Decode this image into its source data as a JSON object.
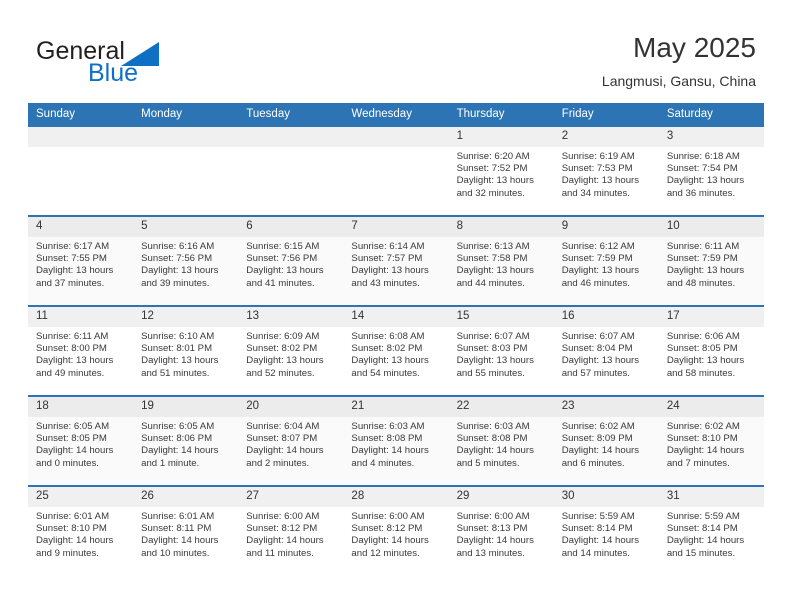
{
  "brand": {
    "name_part1": "General",
    "name_part2": "Blue",
    "accent_color": "#0f6fc5",
    "logo_icon": "triangle-flag-icon"
  },
  "header": {
    "title": "May 2025",
    "subtitle": "Langmusi, Gansu, China"
  },
  "theme": {
    "header_blue": "#2d74b5",
    "daynum_band": "#f0f0f0",
    "row_shade": "#fafafa"
  },
  "weekday_headers": [
    "Sunday",
    "Monday",
    "Tuesday",
    "Wednesday",
    "Thursday",
    "Friday",
    "Saturday"
  ],
  "labels": {
    "sunrise_prefix": "Sunrise:",
    "sunset_prefix": "Sunset:",
    "daylight_prefix": "Daylight:"
  },
  "weeks": [
    {
      "shaded": false,
      "days": [
        {
          "num": "",
          "empty": true,
          "sunrise": "",
          "sunset": "",
          "daylight_line1": "",
          "daylight_line2": ""
        },
        {
          "num": "",
          "empty": true,
          "sunrise": "",
          "sunset": "",
          "daylight_line1": "",
          "daylight_line2": ""
        },
        {
          "num": "",
          "empty": true,
          "sunrise": "",
          "sunset": "",
          "daylight_line1": "",
          "daylight_line2": ""
        },
        {
          "num": "",
          "empty": true,
          "sunrise": "",
          "sunset": "",
          "daylight_line1": "",
          "daylight_line2": ""
        },
        {
          "num": "1",
          "empty": false,
          "sunrise": "Sunrise: 6:20 AM",
          "sunset": "Sunset: 7:52 PM",
          "daylight_line1": "Daylight: 13 hours",
          "daylight_line2": "and 32 minutes."
        },
        {
          "num": "2",
          "empty": false,
          "sunrise": "Sunrise: 6:19 AM",
          "sunset": "Sunset: 7:53 PM",
          "daylight_line1": "Daylight: 13 hours",
          "daylight_line2": "and 34 minutes."
        },
        {
          "num": "3",
          "empty": false,
          "sunrise": "Sunrise: 6:18 AM",
          "sunset": "Sunset: 7:54 PM",
          "daylight_line1": "Daylight: 13 hours",
          "daylight_line2": "and 36 minutes."
        }
      ]
    },
    {
      "shaded": true,
      "days": [
        {
          "num": "4",
          "empty": false,
          "sunrise": "Sunrise: 6:17 AM",
          "sunset": "Sunset: 7:55 PM",
          "daylight_line1": "Daylight: 13 hours",
          "daylight_line2": "and 37 minutes."
        },
        {
          "num": "5",
          "empty": false,
          "sunrise": "Sunrise: 6:16 AM",
          "sunset": "Sunset: 7:56 PM",
          "daylight_line1": "Daylight: 13 hours",
          "daylight_line2": "and 39 minutes."
        },
        {
          "num": "6",
          "empty": false,
          "sunrise": "Sunrise: 6:15 AM",
          "sunset": "Sunset: 7:56 PM",
          "daylight_line1": "Daylight: 13 hours",
          "daylight_line2": "and 41 minutes."
        },
        {
          "num": "7",
          "empty": false,
          "sunrise": "Sunrise: 6:14 AM",
          "sunset": "Sunset: 7:57 PM",
          "daylight_line1": "Daylight: 13 hours",
          "daylight_line2": "and 43 minutes."
        },
        {
          "num": "8",
          "empty": false,
          "sunrise": "Sunrise: 6:13 AM",
          "sunset": "Sunset: 7:58 PM",
          "daylight_line1": "Daylight: 13 hours",
          "daylight_line2": "and 44 minutes."
        },
        {
          "num": "9",
          "empty": false,
          "sunrise": "Sunrise: 6:12 AM",
          "sunset": "Sunset: 7:59 PM",
          "daylight_line1": "Daylight: 13 hours",
          "daylight_line2": "and 46 minutes."
        },
        {
          "num": "10",
          "empty": false,
          "sunrise": "Sunrise: 6:11 AM",
          "sunset": "Sunset: 7:59 PM",
          "daylight_line1": "Daylight: 13 hours",
          "daylight_line2": "and 48 minutes."
        }
      ]
    },
    {
      "shaded": false,
      "days": [
        {
          "num": "11",
          "empty": false,
          "sunrise": "Sunrise: 6:11 AM",
          "sunset": "Sunset: 8:00 PM",
          "daylight_line1": "Daylight: 13 hours",
          "daylight_line2": "and 49 minutes."
        },
        {
          "num": "12",
          "empty": false,
          "sunrise": "Sunrise: 6:10 AM",
          "sunset": "Sunset: 8:01 PM",
          "daylight_line1": "Daylight: 13 hours",
          "daylight_line2": "and 51 minutes."
        },
        {
          "num": "13",
          "empty": false,
          "sunrise": "Sunrise: 6:09 AM",
          "sunset": "Sunset: 8:02 PM",
          "daylight_line1": "Daylight: 13 hours",
          "daylight_line2": "and 52 minutes."
        },
        {
          "num": "14",
          "empty": false,
          "sunrise": "Sunrise: 6:08 AM",
          "sunset": "Sunset: 8:02 PM",
          "daylight_line1": "Daylight: 13 hours",
          "daylight_line2": "and 54 minutes."
        },
        {
          "num": "15",
          "empty": false,
          "sunrise": "Sunrise: 6:07 AM",
          "sunset": "Sunset: 8:03 PM",
          "daylight_line1": "Daylight: 13 hours",
          "daylight_line2": "and 55 minutes."
        },
        {
          "num": "16",
          "empty": false,
          "sunrise": "Sunrise: 6:07 AM",
          "sunset": "Sunset: 8:04 PM",
          "daylight_line1": "Daylight: 13 hours",
          "daylight_line2": "and 57 minutes."
        },
        {
          "num": "17",
          "empty": false,
          "sunrise": "Sunrise: 6:06 AM",
          "sunset": "Sunset: 8:05 PM",
          "daylight_line1": "Daylight: 13 hours",
          "daylight_line2": "and 58 minutes."
        }
      ]
    },
    {
      "shaded": true,
      "days": [
        {
          "num": "18",
          "empty": false,
          "sunrise": "Sunrise: 6:05 AM",
          "sunset": "Sunset: 8:05 PM",
          "daylight_line1": "Daylight: 14 hours",
          "daylight_line2": "and 0 minutes."
        },
        {
          "num": "19",
          "empty": false,
          "sunrise": "Sunrise: 6:05 AM",
          "sunset": "Sunset: 8:06 PM",
          "daylight_line1": "Daylight: 14 hours",
          "daylight_line2": "and 1 minute."
        },
        {
          "num": "20",
          "empty": false,
          "sunrise": "Sunrise: 6:04 AM",
          "sunset": "Sunset: 8:07 PM",
          "daylight_line1": "Daylight: 14 hours",
          "daylight_line2": "and 2 minutes."
        },
        {
          "num": "21",
          "empty": false,
          "sunrise": "Sunrise: 6:03 AM",
          "sunset": "Sunset: 8:08 PM",
          "daylight_line1": "Daylight: 14 hours",
          "daylight_line2": "and 4 minutes."
        },
        {
          "num": "22",
          "empty": false,
          "sunrise": "Sunrise: 6:03 AM",
          "sunset": "Sunset: 8:08 PM",
          "daylight_line1": "Daylight: 14 hours",
          "daylight_line2": "and 5 minutes."
        },
        {
          "num": "23",
          "empty": false,
          "sunrise": "Sunrise: 6:02 AM",
          "sunset": "Sunset: 8:09 PM",
          "daylight_line1": "Daylight: 14 hours",
          "daylight_line2": "and 6 minutes."
        },
        {
          "num": "24",
          "empty": false,
          "sunrise": "Sunrise: 6:02 AM",
          "sunset": "Sunset: 8:10 PM",
          "daylight_line1": "Daylight: 14 hours",
          "daylight_line2": "and 7 minutes."
        }
      ]
    },
    {
      "shaded": false,
      "days": [
        {
          "num": "25",
          "empty": false,
          "sunrise": "Sunrise: 6:01 AM",
          "sunset": "Sunset: 8:10 PM",
          "daylight_line1": "Daylight: 14 hours",
          "daylight_line2": "and 9 minutes."
        },
        {
          "num": "26",
          "empty": false,
          "sunrise": "Sunrise: 6:01 AM",
          "sunset": "Sunset: 8:11 PM",
          "daylight_line1": "Daylight: 14 hours",
          "daylight_line2": "and 10 minutes."
        },
        {
          "num": "27",
          "empty": false,
          "sunrise": "Sunrise: 6:00 AM",
          "sunset": "Sunset: 8:12 PM",
          "daylight_line1": "Daylight: 14 hours",
          "daylight_line2": "and 11 minutes."
        },
        {
          "num": "28",
          "empty": false,
          "sunrise": "Sunrise: 6:00 AM",
          "sunset": "Sunset: 8:12 PM",
          "daylight_line1": "Daylight: 14 hours",
          "daylight_line2": "and 12 minutes."
        },
        {
          "num": "29",
          "empty": false,
          "sunrise": "Sunrise: 6:00 AM",
          "sunset": "Sunset: 8:13 PM",
          "daylight_line1": "Daylight: 14 hours",
          "daylight_line2": "and 13 minutes."
        },
        {
          "num": "30",
          "empty": false,
          "sunrise": "Sunrise: 5:59 AM",
          "sunset": "Sunset: 8:14 PM",
          "daylight_line1": "Daylight: 14 hours",
          "daylight_line2": "and 14 minutes."
        },
        {
          "num": "31",
          "empty": false,
          "sunrise": "Sunrise: 5:59 AM",
          "sunset": "Sunset: 8:14 PM",
          "daylight_line1": "Daylight: 14 hours",
          "daylight_line2": "and 15 minutes."
        }
      ]
    }
  ]
}
